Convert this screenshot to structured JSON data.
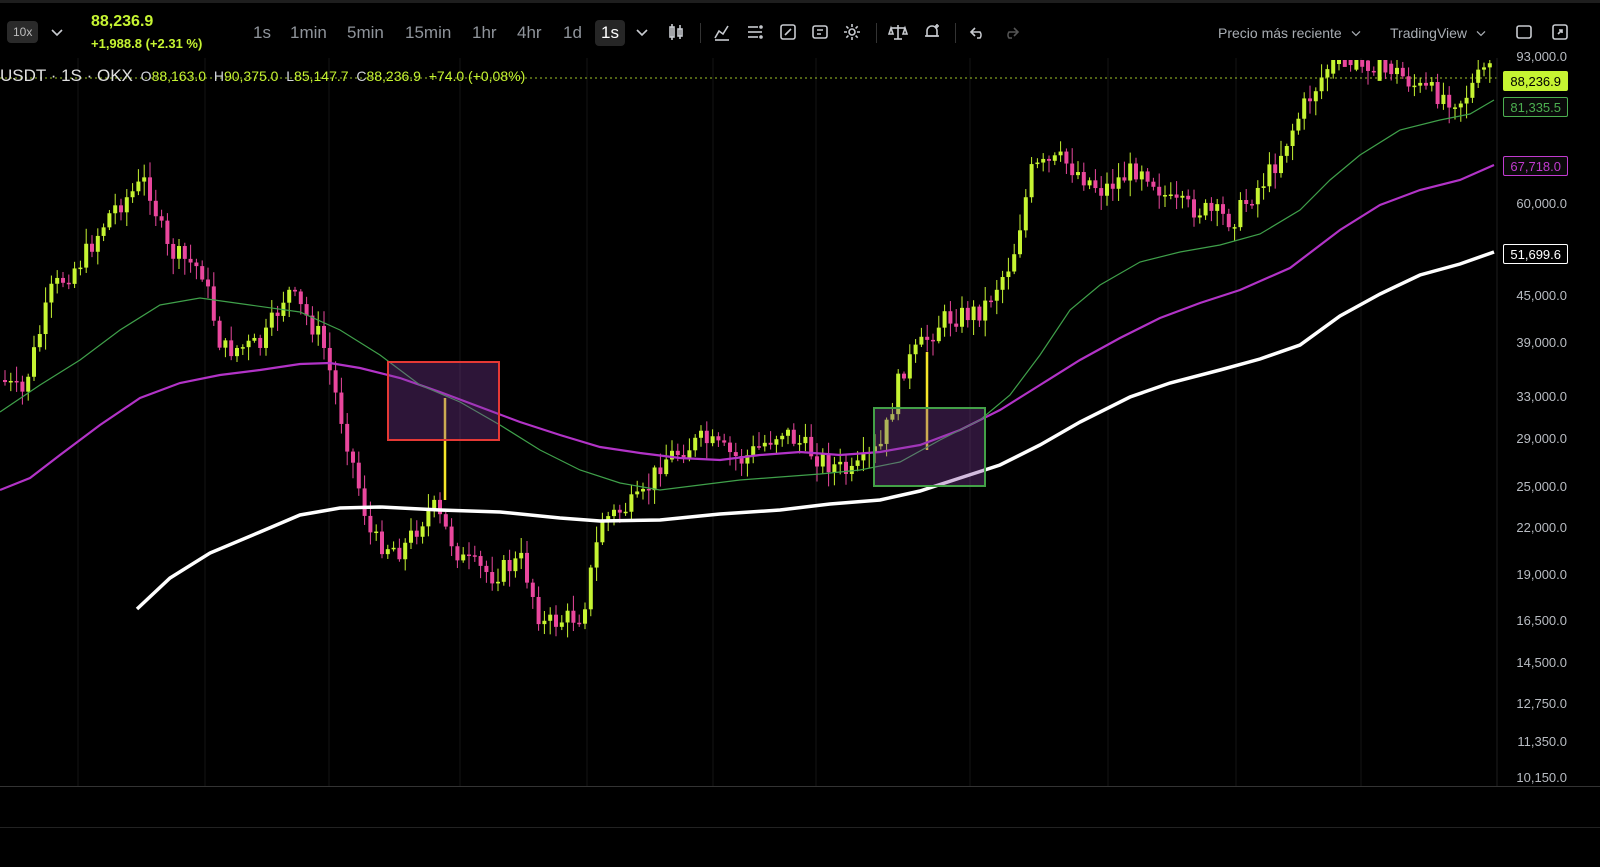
{
  "toolbar": {
    "leverage": "10x",
    "last_price": "88,236.9",
    "change": "+1,988.8 (+2.31 %)",
    "timeframes": [
      "1s",
      "1min",
      "5min",
      "15min",
      "1hr",
      "4hr",
      "1d"
    ],
    "active_interval": "1s",
    "price_source": "Precio más reciente",
    "chart_engine": "TradingView"
  },
  "legend": {
    "symbol": "USDT · 1S · OKX",
    "o_label": "O",
    "o_value": "88,163.0",
    "h_label": "H",
    "h_value": "90,375.0",
    "l_label": "L",
    "l_value": "85,147.7",
    "c_label": "C",
    "c_value": "88,236.9",
    "change": "+74.0 (+0,08%)"
  },
  "price_axis": {
    "ticks": [
      "93,000.0",
      "60,000.0",
      "45,000.0",
      "39,000.0",
      "33,000.0",
      "29,000.0",
      "25,000.0",
      "22,000.0",
      "19,000.0",
      "16,500.0",
      "14,500.0",
      "12,750.0",
      "11,350.0",
      "10,150.0"
    ],
    "tags": [
      {
        "text": "88,236.9",
        "bg": "#c6f432",
        "fg": "#000000",
        "border": "#c6f432"
      },
      {
        "text": "81,335.5",
        "bg": "#0a0a0a",
        "fg": "#4caf50",
        "border": "#4caf50"
      },
      {
        "text": "67,718.0",
        "bg": "#0a0a0a",
        "fg": "#c13bd0",
        "border": "#c13bd0"
      },
      {
        "text": "51,699.6",
        "bg": "#000000",
        "fg": "#ffffff",
        "border": "#ffffff"
      }
    ]
  },
  "colors": {
    "up": "#c6f432",
    "down": "#e9479d",
    "ma_fast": "#3fa04a",
    "ma_mid": "#b233c7",
    "ma_slow": "#ffffff",
    "box_red": "#e53935",
    "box_green": "#43a047"
  }
}
